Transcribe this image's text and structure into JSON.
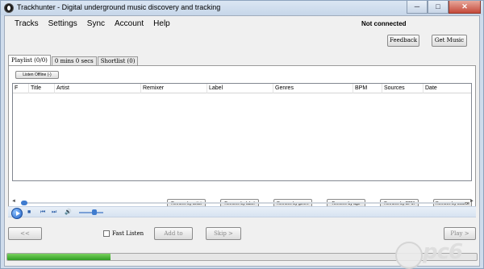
{
  "window": {
    "title": "Trackhunter - Digital underground music discovery and tracking",
    "controls": [
      "─",
      "□",
      "✕"
    ]
  },
  "menu": [
    "Tracks",
    "Settings",
    "Sync",
    "Account",
    "Help"
  ],
  "status": {
    "connection": "Not connected"
  },
  "top_buttons": {
    "feedback": "Feedback",
    "get_music": "Get Music"
  },
  "tabs": [
    {
      "label": "Playlist (0/0)",
      "active": true
    },
    {
      "label": "0 mins 0 secs",
      "active": false
    },
    {
      "label": "Shortlist (0)",
      "active": false
    }
  ],
  "listen_offline": "Listen Offline (-)",
  "grid": {
    "columns": [
      "F",
      "Title",
      "Artist",
      "Remixer",
      "Label",
      "Genres",
      "BPM",
      "Sources",
      "Date"
    ],
    "rows": []
  },
  "remove_buttons": [
    "Remove by artist",
    "Remove by label",
    "Remove by genre",
    "Remove by age",
    "Remove by BPM",
    "Remove by source"
  ],
  "controls": {
    "prev": "<<",
    "fast_listen": "Fast Listen",
    "fast_listen_checked": false,
    "add_to": "Add to",
    "skip": "Skip >",
    "play": "Play >"
  },
  "progress": {
    "fraction": 0.22,
    "color": "#2f9e22"
  },
  "seek_arrows": {
    "left": "◄",
    "right": "►"
  },
  "player_icons": {
    "stop": "■",
    "previous": "⏮",
    "next": "⏭",
    "volume": "🔊"
  },
  "watermark": {
    "text": "pc6",
    "subtitle": "下载站"
  }
}
